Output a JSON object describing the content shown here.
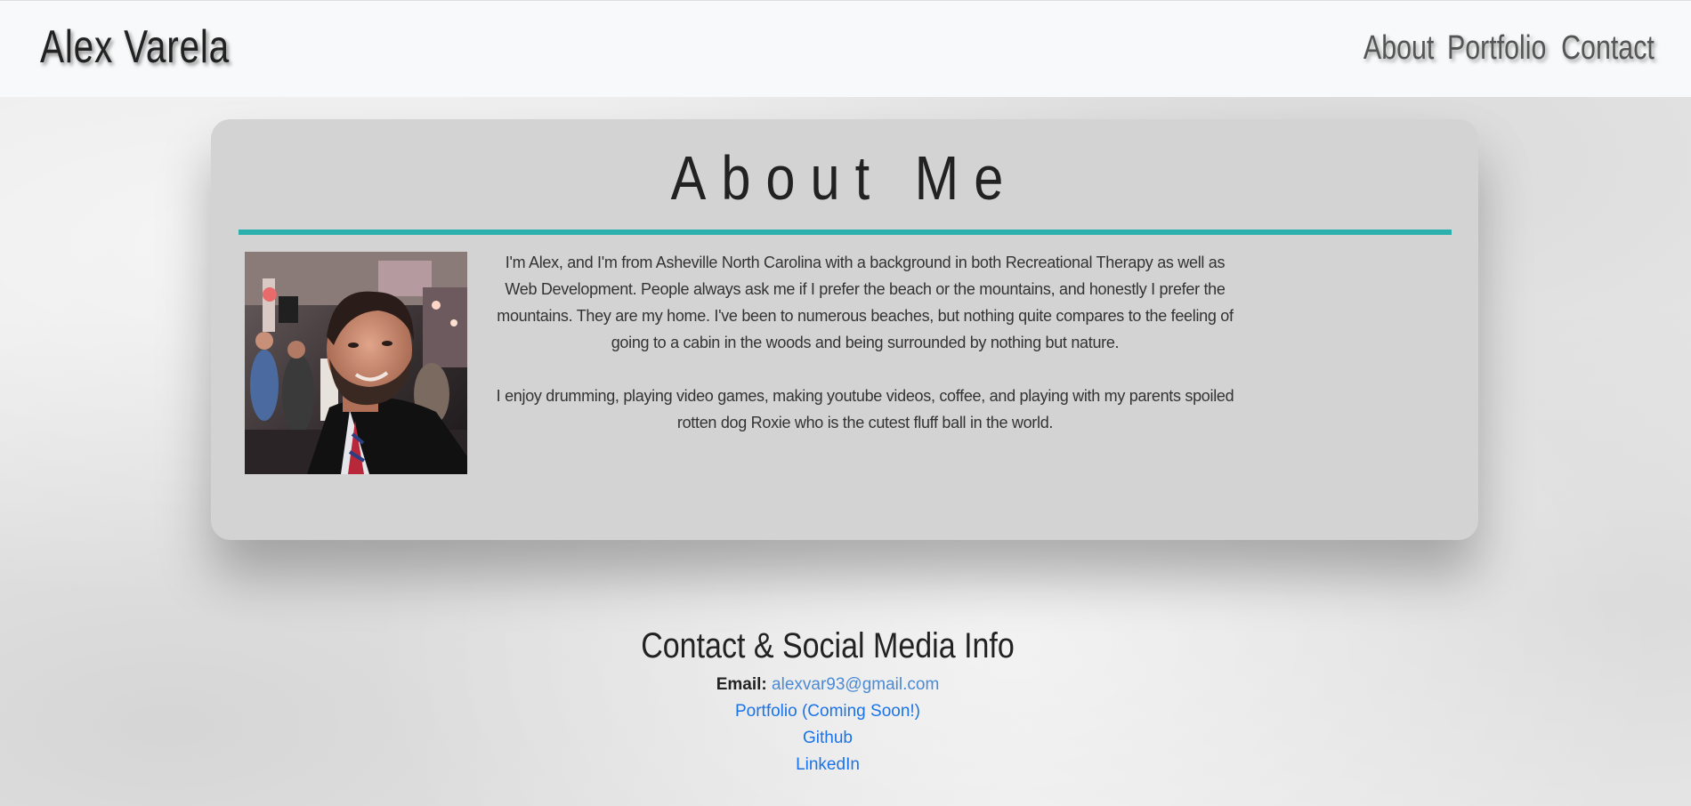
{
  "header": {
    "brand": "Alex Varela",
    "nav": [
      {
        "label": "About"
      },
      {
        "label": "Portfolio"
      },
      {
        "label": "Contact"
      }
    ]
  },
  "about": {
    "title": "About Me",
    "photo_alt": "profile photo",
    "paragraphs": [
      "I'm Alex, and I'm from Asheville North Carolina with a background in both Recreational Therapy as well as Web Development. People always ask me if I prefer the beach or the mountains, and honestly I prefer the mountains. They are my home. I've been to numerous beaches, but nothing quite compares to the feeling of going to a cabin in the woods and being surrounded by nothing but nature.",
      "I enjoy drumming, playing video games, making youtube videos, coffee, and playing with my parents spoiled rotten dog Roxie who is the cutest fluff ball in the world."
    ]
  },
  "contact": {
    "title": "Contact & Social Media Info",
    "email_label": "Email:",
    "email": "alexvar93@gmail.com",
    "links": [
      {
        "label": "Portfolio (Coming Soon!)"
      },
      {
        "label": "Github"
      },
      {
        "label": "LinkedIn"
      }
    ]
  },
  "colors": {
    "accent_rule": "#2cb0ae",
    "link": "#1a73e8",
    "card": "#d3d3d3",
    "navbar": "#f8f9fa"
  }
}
